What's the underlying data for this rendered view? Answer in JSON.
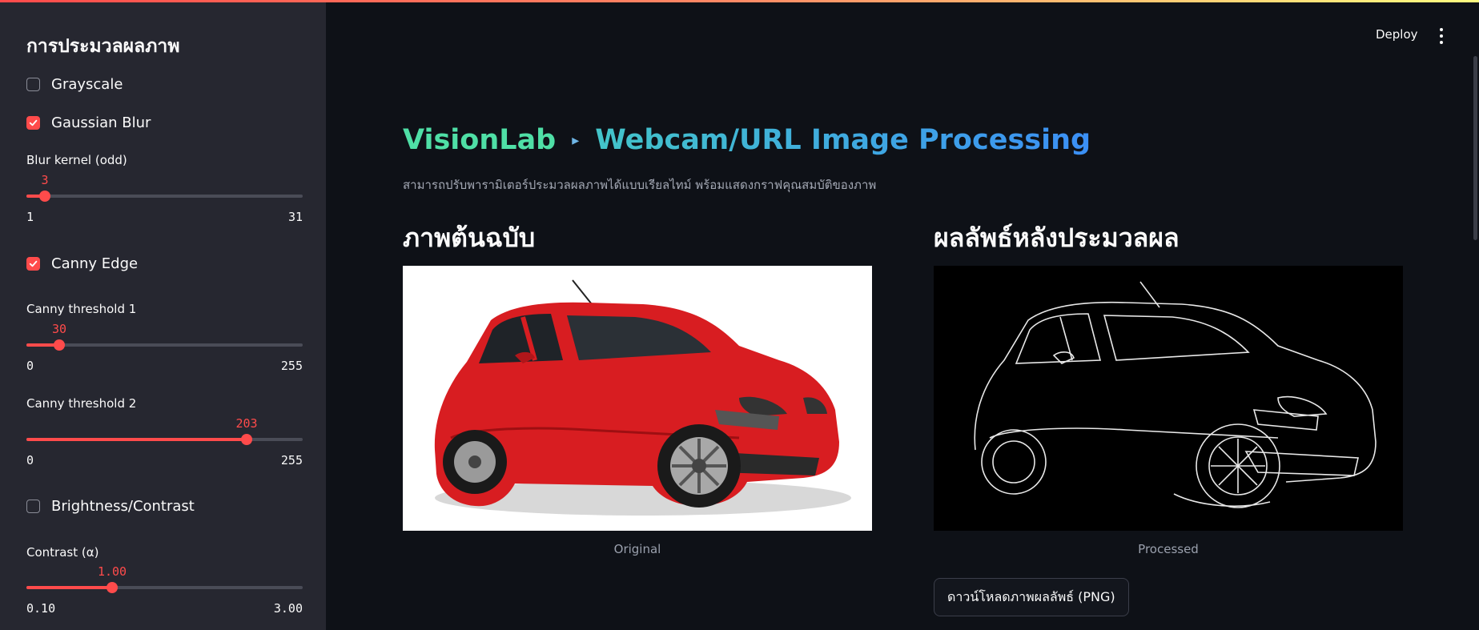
{
  "sidebar": {
    "title": "การประมวลผลภาพ",
    "checks": {
      "grayscale": {
        "label": "Grayscale",
        "checked": false
      },
      "gaussian": {
        "label": "Gaussian Blur",
        "checked": true
      },
      "canny": {
        "label": "Canny Edge",
        "checked": true
      },
      "brightness": {
        "label": "Brightness/Contrast",
        "checked": false
      }
    },
    "sliders": {
      "blur": {
        "label": "Blur kernel (odd)",
        "value": "3",
        "min": "1",
        "max": "31",
        "fraction": 0.0667
      },
      "t1": {
        "label": "Canny threshold 1",
        "value": "30",
        "min": "0",
        "max": "255",
        "fraction": 0.1176
      },
      "t2": {
        "label": "Canny threshold 2",
        "value": "203",
        "min": "0",
        "max": "255",
        "fraction": 0.796
      },
      "contrast": {
        "label": "Contrast (α)",
        "value": "1.00",
        "min": "0.10",
        "max": "3.00",
        "fraction": 0.3103
      }
    },
    "accent": "#ff4b4b"
  },
  "header": {
    "deploy_label": "Deploy",
    "menu_icon": "kebab-menu-icon"
  },
  "main": {
    "title_left": "VisionLab",
    "title_arrow": "▸",
    "title_right": "Webcam/URL Image Processing",
    "subtitle": "สามารถปรับพารามิเตอร์ประมวลผลภาพได้แบบเรียลไทม์ พร้อมแสดงกราฟคุณสมบัติของภาพ",
    "original": {
      "heading": "ภาพต้นฉบับ",
      "caption": "Original"
    },
    "processed": {
      "heading": "ผลลัพธ์หลังประมวลผล",
      "caption": "Processed"
    },
    "download_label": "ดาวน์โหลดภาพผลลัพธ์ (PNG)"
  }
}
